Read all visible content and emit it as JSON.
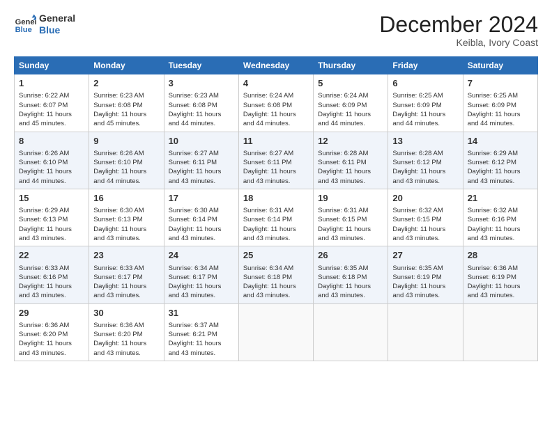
{
  "header": {
    "logo_line1": "General",
    "logo_line2": "Blue",
    "title": "December 2024",
    "location": "Keibla, Ivory Coast"
  },
  "days_of_week": [
    "Sunday",
    "Monday",
    "Tuesday",
    "Wednesday",
    "Thursday",
    "Friday",
    "Saturday"
  ],
  "weeks": [
    [
      {
        "day": 1,
        "sunrise": "6:22 AM",
        "sunset": "6:07 PM",
        "daylight": "11 hours and 45 minutes."
      },
      {
        "day": 2,
        "sunrise": "6:23 AM",
        "sunset": "6:08 PM",
        "daylight": "11 hours and 45 minutes."
      },
      {
        "day": 3,
        "sunrise": "6:23 AM",
        "sunset": "6:08 PM",
        "daylight": "11 hours and 44 minutes."
      },
      {
        "day": 4,
        "sunrise": "6:24 AM",
        "sunset": "6:08 PM",
        "daylight": "11 hours and 44 minutes."
      },
      {
        "day": 5,
        "sunrise": "6:24 AM",
        "sunset": "6:09 PM",
        "daylight": "11 hours and 44 minutes."
      },
      {
        "day": 6,
        "sunrise": "6:25 AM",
        "sunset": "6:09 PM",
        "daylight": "11 hours and 44 minutes."
      },
      {
        "day": 7,
        "sunrise": "6:25 AM",
        "sunset": "6:09 PM",
        "daylight": "11 hours and 44 minutes."
      }
    ],
    [
      {
        "day": 8,
        "sunrise": "6:26 AM",
        "sunset": "6:10 PM",
        "daylight": "11 hours and 44 minutes."
      },
      {
        "day": 9,
        "sunrise": "6:26 AM",
        "sunset": "6:10 PM",
        "daylight": "11 hours and 44 minutes."
      },
      {
        "day": 10,
        "sunrise": "6:27 AM",
        "sunset": "6:11 PM",
        "daylight": "11 hours and 43 minutes."
      },
      {
        "day": 11,
        "sunrise": "6:27 AM",
        "sunset": "6:11 PM",
        "daylight": "11 hours and 43 minutes."
      },
      {
        "day": 12,
        "sunrise": "6:28 AM",
        "sunset": "6:11 PM",
        "daylight": "11 hours and 43 minutes."
      },
      {
        "day": 13,
        "sunrise": "6:28 AM",
        "sunset": "6:12 PM",
        "daylight": "11 hours and 43 minutes."
      },
      {
        "day": 14,
        "sunrise": "6:29 AM",
        "sunset": "6:12 PM",
        "daylight": "11 hours and 43 minutes."
      }
    ],
    [
      {
        "day": 15,
        "sunrise": "6:29 AM",
        "sunset": "6:13 PM",
        "daylight": "11 hours and 43 minutes."
      },
      {
        "day": 16,
        "sunrise": "6:30 AM",
        "sunset": "6:13 PM",
        "daylight": "11 hours and 43 minutes."
      },
      {
        "day": 17,
        "sunrise": "6:30 AM",
        "sunset": "6:14 PM",
        "daylight": "11 hours and 43 minutes."
      },
      {
        "day": 18,
        "sunrise": "6:31 AM",
        "sunset": "6:14 PM",
        "daylight": "11 hours and 43 minutes."
      },
      {
        "day": 19,
        "sunrise": "6:31 AM",
        "sunset": "6:15 PM",
        "daylight": "11 hours and 43 minutes."
      },
      {
        "day": 20,
        "sunrise": "6:32 AM",
        "sunset": "6:15 PM",
        "daylight": "11 hours and 43 minutes."
      },
      {
        "day": 21,
        "sunrise": "6:32 AM",
        "sunset": "6:16 PM",
        "daylight": "11 hours and 43 minutes."
      }
    ],
    [
      {
        "day": 22,
        "sunrise": "6:33 AM",
        "sunset": "6:16 PM",
        "daylight": "11 hours and 43 minutes."
      },
      {
        "day": 23,
        "sunrise": "6:33 AM",
        "sunset": "6:17 PM",
        "daylight": "11 hours and 43 minutes."
      },
      {
        "day": 24,
        "sunrise": "6:34 AM",
        "sunset": "6:17 PM",
        "daylight": "11 hours and 43 minutes."
      },
      {
        "day": 25,
        "sunrise": "6:34 AM",
        "sunset": "6:18 PM",
        "daylight": "11 hours and 43 minutes."
      },
      {
        "day": 26,
        "sunrise": "6:35 AM",
        "sunset": "6:18 PM",
        "daylight": "11 hours and 43 minutes."
      },
      {
        "day": 27,
        "sunrise": "6:35 AM",
        "sunset": "6:19 PM",
        "daylight": "11 hours and 43 minutes."
      },
      {
        "day": 28,
        "sunrise": "6:36 AM",
        "sunset": "6:19 PM",
        "daylight": "11 hours and 43 minutes."
      }
    ],
    [
      {
        "day": 29,
        "sunrise": "6:36 AM",
        "sunset": "6:20 PM",
        "daylight": "11 hours and 43 minutes."
      },
      {
        "day": 30,
        "sunrise": "6:36 AM",
        "sunset": "6:20 PM",
        "daylight": "11 hours and 43 minutes."
      },
      {
        "day": 31,
        "sunrise": "6:37 AM",
        "sunset": "6:21 PM",
        "daylight": "11 hours and 43 minutes."
      },
      null,
      null,
      null,
      null
    ]
  ]
}
